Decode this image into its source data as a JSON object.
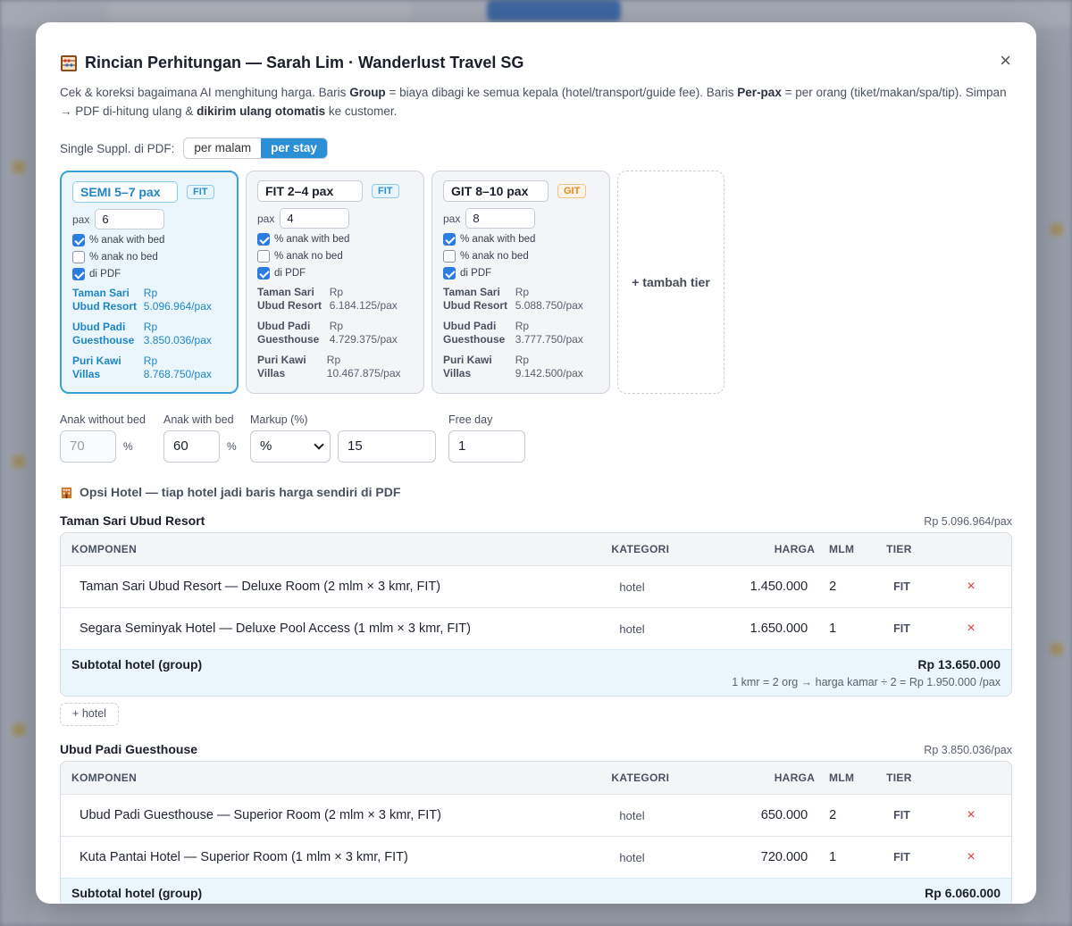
{
  "modal": {
    "title": "Rincian Perhitungan — Sarah Lim · Wanderlust Travel SG",
    "close": "×",
    "desc": {
      "p1": "Cek & koreksi bagaimana AI menghitung harga. Baris ",
      "b1": "Group",
      "p2": " = biaya dibagi ke semua kepala (hotel/transport/guide fee). Baris ",
      "b2": "Per-pax",
      "p3": " = per orang (tiket/makan/spa/tip). Simpan → PDF di-hitung ulang & ",
      "b3": "dikirim ulang otomatis",
      "p4": " ke customer."
    },
    "single_suppl": {
      "label": "Single Suppl. di PDF:",
      "options": [
        "per malam",
        "per stay"
      ],
      "selected": "per stay"
    }
  },
  "tiers": [
    {
      "name": "SEMI 5–7 pax",
      "badge": "FIT",
      "pax_label": "pax",
      "pax": "6",
      "checks": [
        {
          "label": "% anak with bed",
          "checked": true
        },
        {
          "label": "% anak no bed",
          "checked": false
        },
        {
          "label": "di PDF",
          "checked": true
        }
      ],
      "hotels": [
        {
          "name": "Taman Sari Ubud Resort",
          "price": "Rp 5.096.964/pax"
        },
        {
          "name": "Ubud Padi Guesthouse",
          "price": "Rp 3.850.036/pax"
        },
        {
          "name": "Puri Kawi Villas",
          "price": "Rp 8.768.750/pax"
        }
      ]
    },
    {
      "name": "FIT 2–4 pax",
      "badge": "FIT",
      "pax_label": "pax",
      "pax": "4",
      "checks": [
        {
          "label": "% anak with bed",
          "checked": true
        },
        {
          "label": "% anak no bed",
          "checked": false
        },
        {
          "label": "di PDF",
          "checked": true
        }
      ],
      "hotels": [
        {
          "name": "Taman Sari Ubud Resort",
          "price": "Rp 6.184.125/pax"
        },
        {
          "name": "Ubud Padi Guesthouse",
          "price": "Rp 4.729.375/pax"
        },
        {
          "name": "Puri Kawi Villas",
          "price": "Rp 10.467.875/pax"
        }
      ]
    },
    {
      "name": "GIT 8–10 pax",
      "badge": "GIT",
      "pax_label": "pax",
      "pax": "8",
      "checks": [
        {
          "label": "% anak with bed",
          "checked": true
        },
        {
          "label": "% anak no bed",
          "checked": false
        },
        {
          "label": "di PDF",
          "checked": true
        }
      ],
      "hotels": [
        {
          "name": "Taman Sari Ubud Resort",
          "price": "Rp 5.088.750/pax"
        },
        {
          "name": "Ubud Padi Guesthouse",
          "price": "Rp 3.777.750/pax"
        },
        {
          "name": "Puri Kawi Villas",
          "price": "Rp 9.142.500/pax"
        }
      ]
    }
  ],
  "add_tier": "+ tambah tier",
  "params": {
    "anak_without_bed": {
      "label": "Anak without bed",
      "value": "70",
      "unit": "%"
    },
    "anak_with_bed": {
      "label": "Anak with bed",
      "value": "60",
      "unit": "%"
    },
    "markup": {
      "label": "Markup (%)",
      "type": "%",
      "value": "15"
    },
    "free_day": {
      "label": "Free day",
      "value": "1"
    }
  },
  "section_title": "Opsi Hotel — tiap hotel jadi baris harga sendiri di PDF",
  "table_headers": {
    "komponen": "KOMPONEN",
    "kategori": "KATEGORI",
    "harga": "HARGA",
    "mlm": "MLM",
    "tier": "TIER"
  },
  "hotel_blocks": [
    {
      "name": "Taman Sari Ubud Resort",
      "price": "Rp 5.096.964/pax",
      "rows": [
        {
          "komponen": "Taman Sari Ubud Resort — Deluxe Room (2 mlm × 3 kmr, FIT)",
          "kategori": "hotel",
          "harga": "1.450.000",
          "mlm": "2",
          "tier": "FIT",
          "del": "×"
        },
        {
          "komponen": "Segara Seminyak Hotel — Deluxe Pool Access (1 mlm × 3 kmr, FIT)",
          "kategori": "hotel",
          "harga": "1.650.000",
          "mlm": "1",
          "tier": "FIT",
          "del": "×"
        }
      ],
      "subtotal_label": "Subtotal hotel (group)",
      "subtotal": "Rp 13.650.000",
      "note": "1 kmr = 2 org → harga kamar ÷ 2 = Rp 1.950.000 /pax"
    },
    {
      "name": "Ubud Padi Guesthouse",
      "price": "Rp 3.850.036/pax",
      "rows": [
        {
          "komponen": "Ubud Padi Guesthouse — Superior Room (2 mlm × 3 kmr, FIT)",
          "kategori": "hotel",
          "harga": "650.000",
          "mlm": "2",
          "tier": "FIT",
          "del": "×"
        },
        {
          "komponen": "Kuta Pantai Hotel — Superior Room (1 mlm × 3 kmr, FIT)",
          "kategori": "hotel",
          "harga": "720.000",
          "mlm": "1",
          "tier": "FIT",
          "del": "×"
        }
      ],
      "subtotal_label": "Subtotal hotel (group)",
      "subtotal": "Rp 6.060.000"
    }
  ],
  "add_hotel": "+ hotel",
  "colors": {
    "accent": "#2b8fd6",
    "danger": "#e0393e",
    "git": "#e48a22"
  }
}
